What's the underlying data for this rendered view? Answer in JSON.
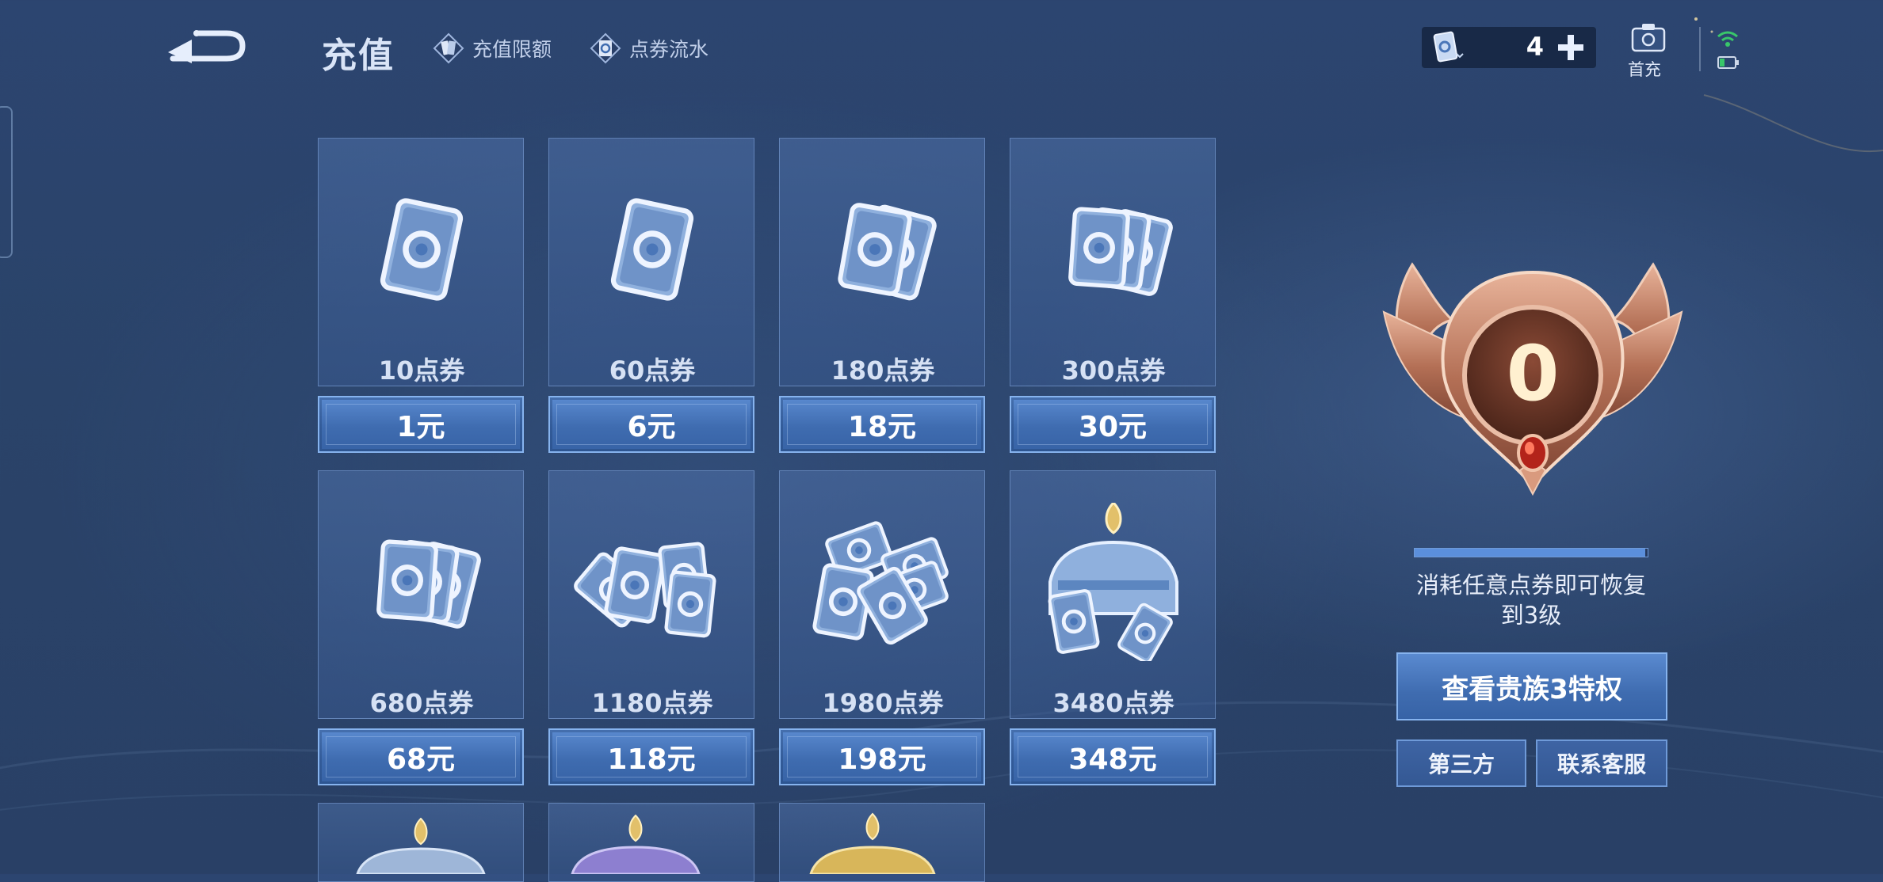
{
  "header": {
    "title": "充值",
    "links": [
      {
        "label": "充值限额",
        "icon": "card-icon"
      },
      {
        "label": "点券流水",
        "icon": "coupon-icon"
      }
    ]
  },
  "currency": {
    "value": "4",
    "icon": "coupon-icon"
  },
  "first_charge": {
    "label": "首充",
    "icon": "gift-icon"
  },
  "packages": [
    {
      "name": "10点券",
      "price": "1元"
    },
    {
      "name": "60点券",
      "price": "6元"
    },
    {
      "name": "180点券",
      "price": "18元"
    },
    {
      "name": "300点券",
      "price": "30元"
    },
    {
      "name": "680点券",
      "price": "68元"
    },
    {
      "name": "1180点券",
      "price": "118元"
    },
    {
      "name": "1980点券",
      "price": "198元"
    },
    {
      "name": "3480点券",
      "price": "348元"
    }
  ],
  "noble": {
    "level": "0",
    "progress": 0.99,
    "restore_text_line1": "消耗任意点券即可恢复",
    "restore_text_line2": "到3级",
    "view_button": "查看贵族3特权"
  },
  "buttons": {
    "third_party": "第三方",
    "contact": "联系客服"
  },
  "colors": {
    "background": "#2a4369",
    "button": "#4a7bc2",
    "button_border": "#86b3ee",
    "badge": "#b8735c"
  }
}
